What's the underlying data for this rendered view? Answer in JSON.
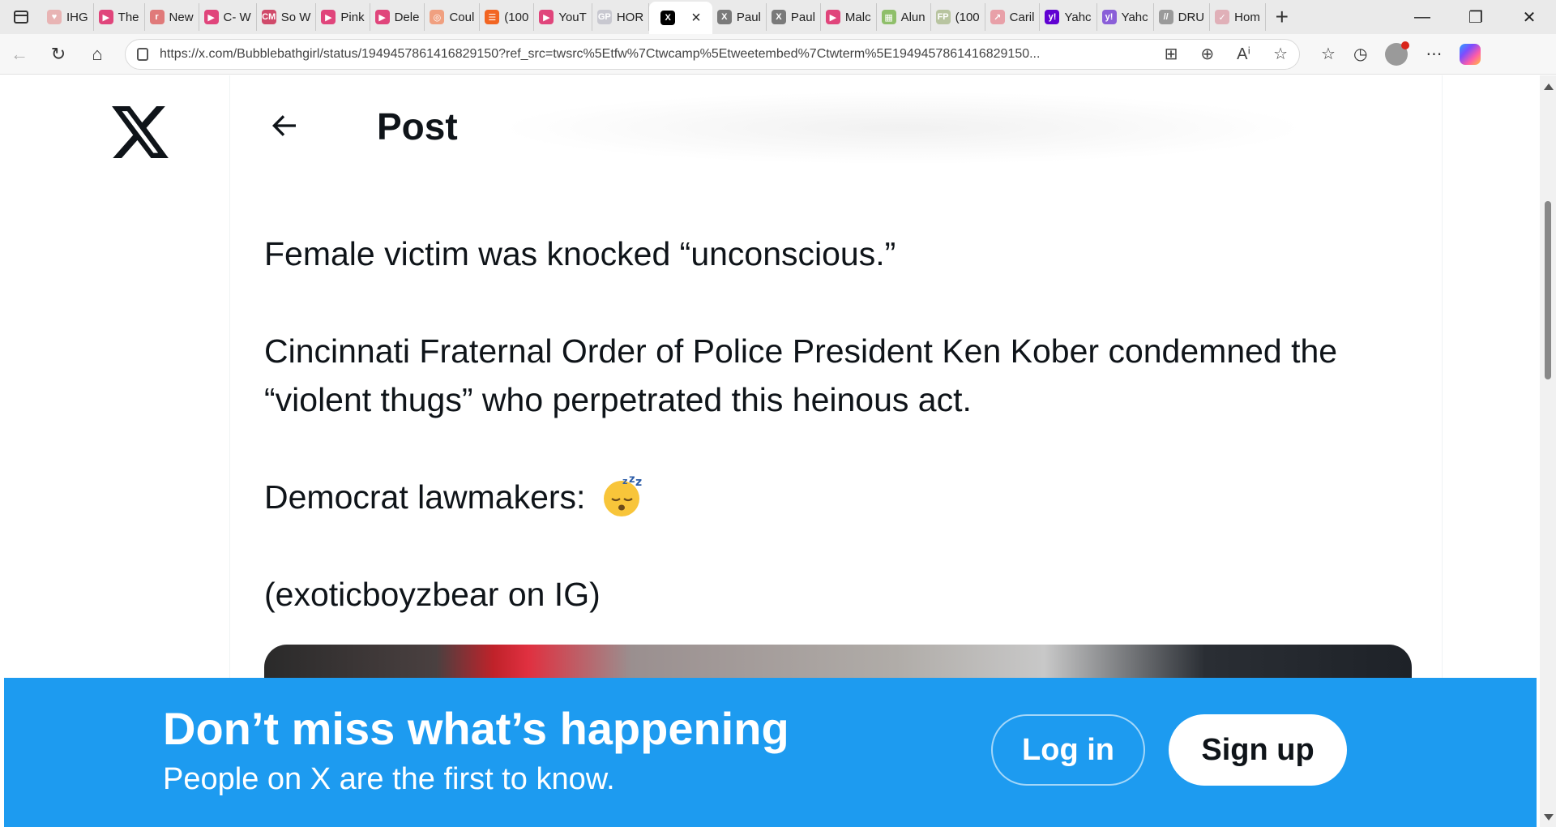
{
  "browser": {
    "tabs": [
      {
        "label": "IHG",
        "icon": "ihg-icon",
        "color": "#e8b4b4"
      },
      {
        "label": "The",
        "icon": "youtube-icon",
        "color": "#e0457b"
      },
      {
        "label": "New",
        "icon": "r-icon",
        "color": "#e07a7a"
      },
      {
        "label": "C- W",
        "icon": "youtube-icon",
        "color": "#e0457b"
      },
      {
        "label": "So W",
        "icon": "cm-icon",
        "color": "#d04a6a"
      },
      {
        "label": "Pink",
        "icon": "youtube-icon",
        "color": "#e0457b"
      },
      {
        "label": "Dele",
        "icon": "youtube-icon",
        "color": "#e0457b"
      },
      {
        "label": "Coul",
        "icon": "circle-icon",
        "color": "#f0a080"
      },
      {
        "label": "(100",
        "icon": "bookmark-icon",
        "color": "#f26522"
      },
      {
        "label": "YouT",
        "icon": "youtube-icon",
        "color": "#e0457b"
      },
      {
        "label": "HOR",
        "icon": "gp-icon",
        "color": "#c8c8d0"
      },
      {
        "label": "Paul",
        "icon": "x-icon",
        "color": "#7a7a7a"
      },
      {
        "label": "Paul",
        "icon": "x-icon",
        "color": "#7a7a7a"
      },
      {
        "label": "Malc",
        "icon": "youtube-icon",
        "color": "#e0457b"
      },
      {
        "label": "Alun",
        "icon": "map-icon",
        "color": "#8fbf6a"
      },
      {
        "label": "(100",
        "icon": "fp-icon",
        "color": "#b8c4a0"
      },
      {
        "label": "Caril",
        "icon": "arrow-icon",
        "color": "#e8a0a8"
      },
      {
        "label": "Yahc",
        "icon": "yahoo-icon",
        "color": "#6001d2"
      },
      {
        "label": "Yahc",
        "icon": "yahoo-icon",
        "color": "#8a5fd8"
      },
      {
        "label": "DRU",
        "icon": "dr-icon",
        "color": "#9a9a9a"
      },
      {
        "label": "Hom",
        "icon": "check-icon",
        "color": "#e0b0b8"
      }
    ],
    "active_tab_close": "×",
    "new_tab": "+",
    "url": "https://x.com/Bubblebathgirl/status/1949457861416829150?ref_src=twsrc%5Etfw%7Ctwcamp%5Etweetembed%7Ctwterm%5E1949457861416829150..."
  },
  "header": {
    "title": "Post"
  },
  "tweet": {
    "line1": "Female victim was knocked “unconscious.”",
    "line2a": "Cincinnati Fraternal Order of Police President Ken Kober condemned the",
    "line2b": "“violent thugs” who perpetrated this heinous act.",
    "line3": "Democrat lawmakers:",
    "line3_emoji": "sleeping-face-emoji",
    "line4": "(exoticboyzbear on IG)"
  },
  "banner": {
    "title": "Don’t miss what’s happening",
    "subtitle": "People on X are the first to know.",
    "login_label": "Log in",
    "signup_label": "Sign up",
    "color": "#1d9bf0"
  }
}
